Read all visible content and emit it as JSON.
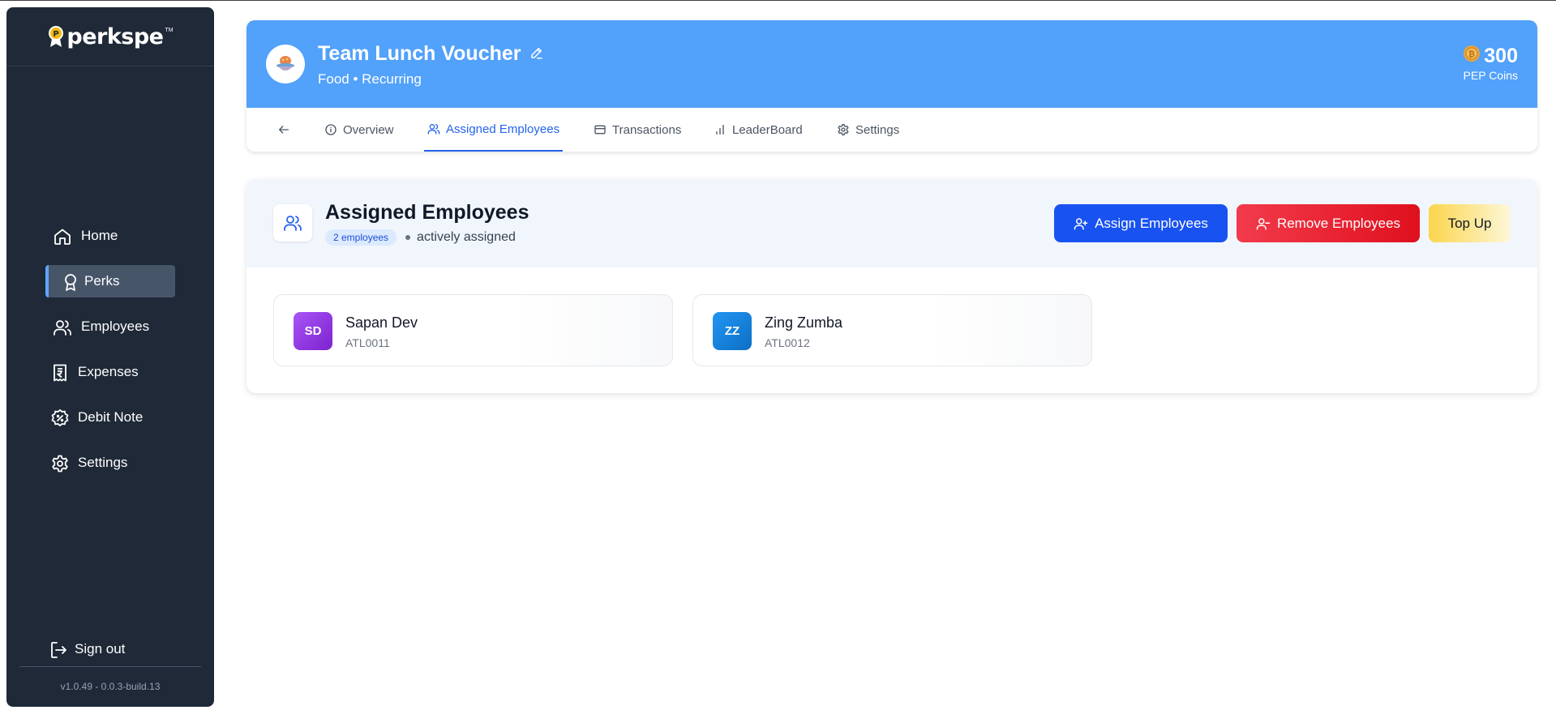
{
  "brand": {
    "name": "perkspe",
    "tm": "TM"
  },
  "sidebar": {
    "items": [
      {
        "label": "Home",
        "icon": "home-icon"
      },
      {
        "label": "Perks",
        "icon": "award-icon",
        "active": true
      },
      {
        "label": "Employees",
        "icon": "users-icon"
      },
      {
        "label": "Expenses",
        "icon": "receipt-icon"
      },
      {
        "label": "Debit Note",
        "icon": "percent-badge-icon"
      },
      {
        "label": "Settings",
        "icon": "gear-icon"
      }
    ],
    "signout": "Sign out",
    "version": "v1.0.49 - 0.0.3-build.13"
  },
  "perk": {
    "title": "Team Lunch Voucher",
    "subtitle": "Food • Recurring",
    "coins_value": "300",
    "coins_label": "PEP Coins",
    "banner_color": "#52a1fb"
  },
  "tabs": [
    {
      "label": "Overview",
      "icon": "info-icon"
    },
    {
      "label": "Assigned Employees",
      "icon": "users-icon",
      "active": true
    },
    {
      "label": "Transactions",
      "icon": "card-icon"
    },
    {
      "label": "LeaderBoard",
      "icon": "bar-chart-icon"
    },
    {
      "label": "Settings",
      "icon": "gear-icon"
    }
  ],
  "assigned": {
    "title": "Assigned Employees",
    "count_badge": "2 employees",
    "status": "actively assigned",
    "buttons": {
      "assign": "Assign Employees",
      "remove": "Remove Employees",
      "topup": "Top Up"
    },
    "employees": [
      {
        "initials": "SD",
        "name": "Sapan Dev",
        "code": "ATL0011",
        "color": "#9333ea"
      },
      {
        "initials": "ZZ",
        "name": "Zing Zumba",
        "code": "ATL0012",
        "color": "#1e88e5"
      }
    ]
  },
  "colors": {
    "accent": "#2563eb",
    "assign_button": "#1852f0",
    "remove_button": "#e0101e",
    "topup_button": "#fbd54c",
    "sidebar_bg": "#1f2937"
  }
}
